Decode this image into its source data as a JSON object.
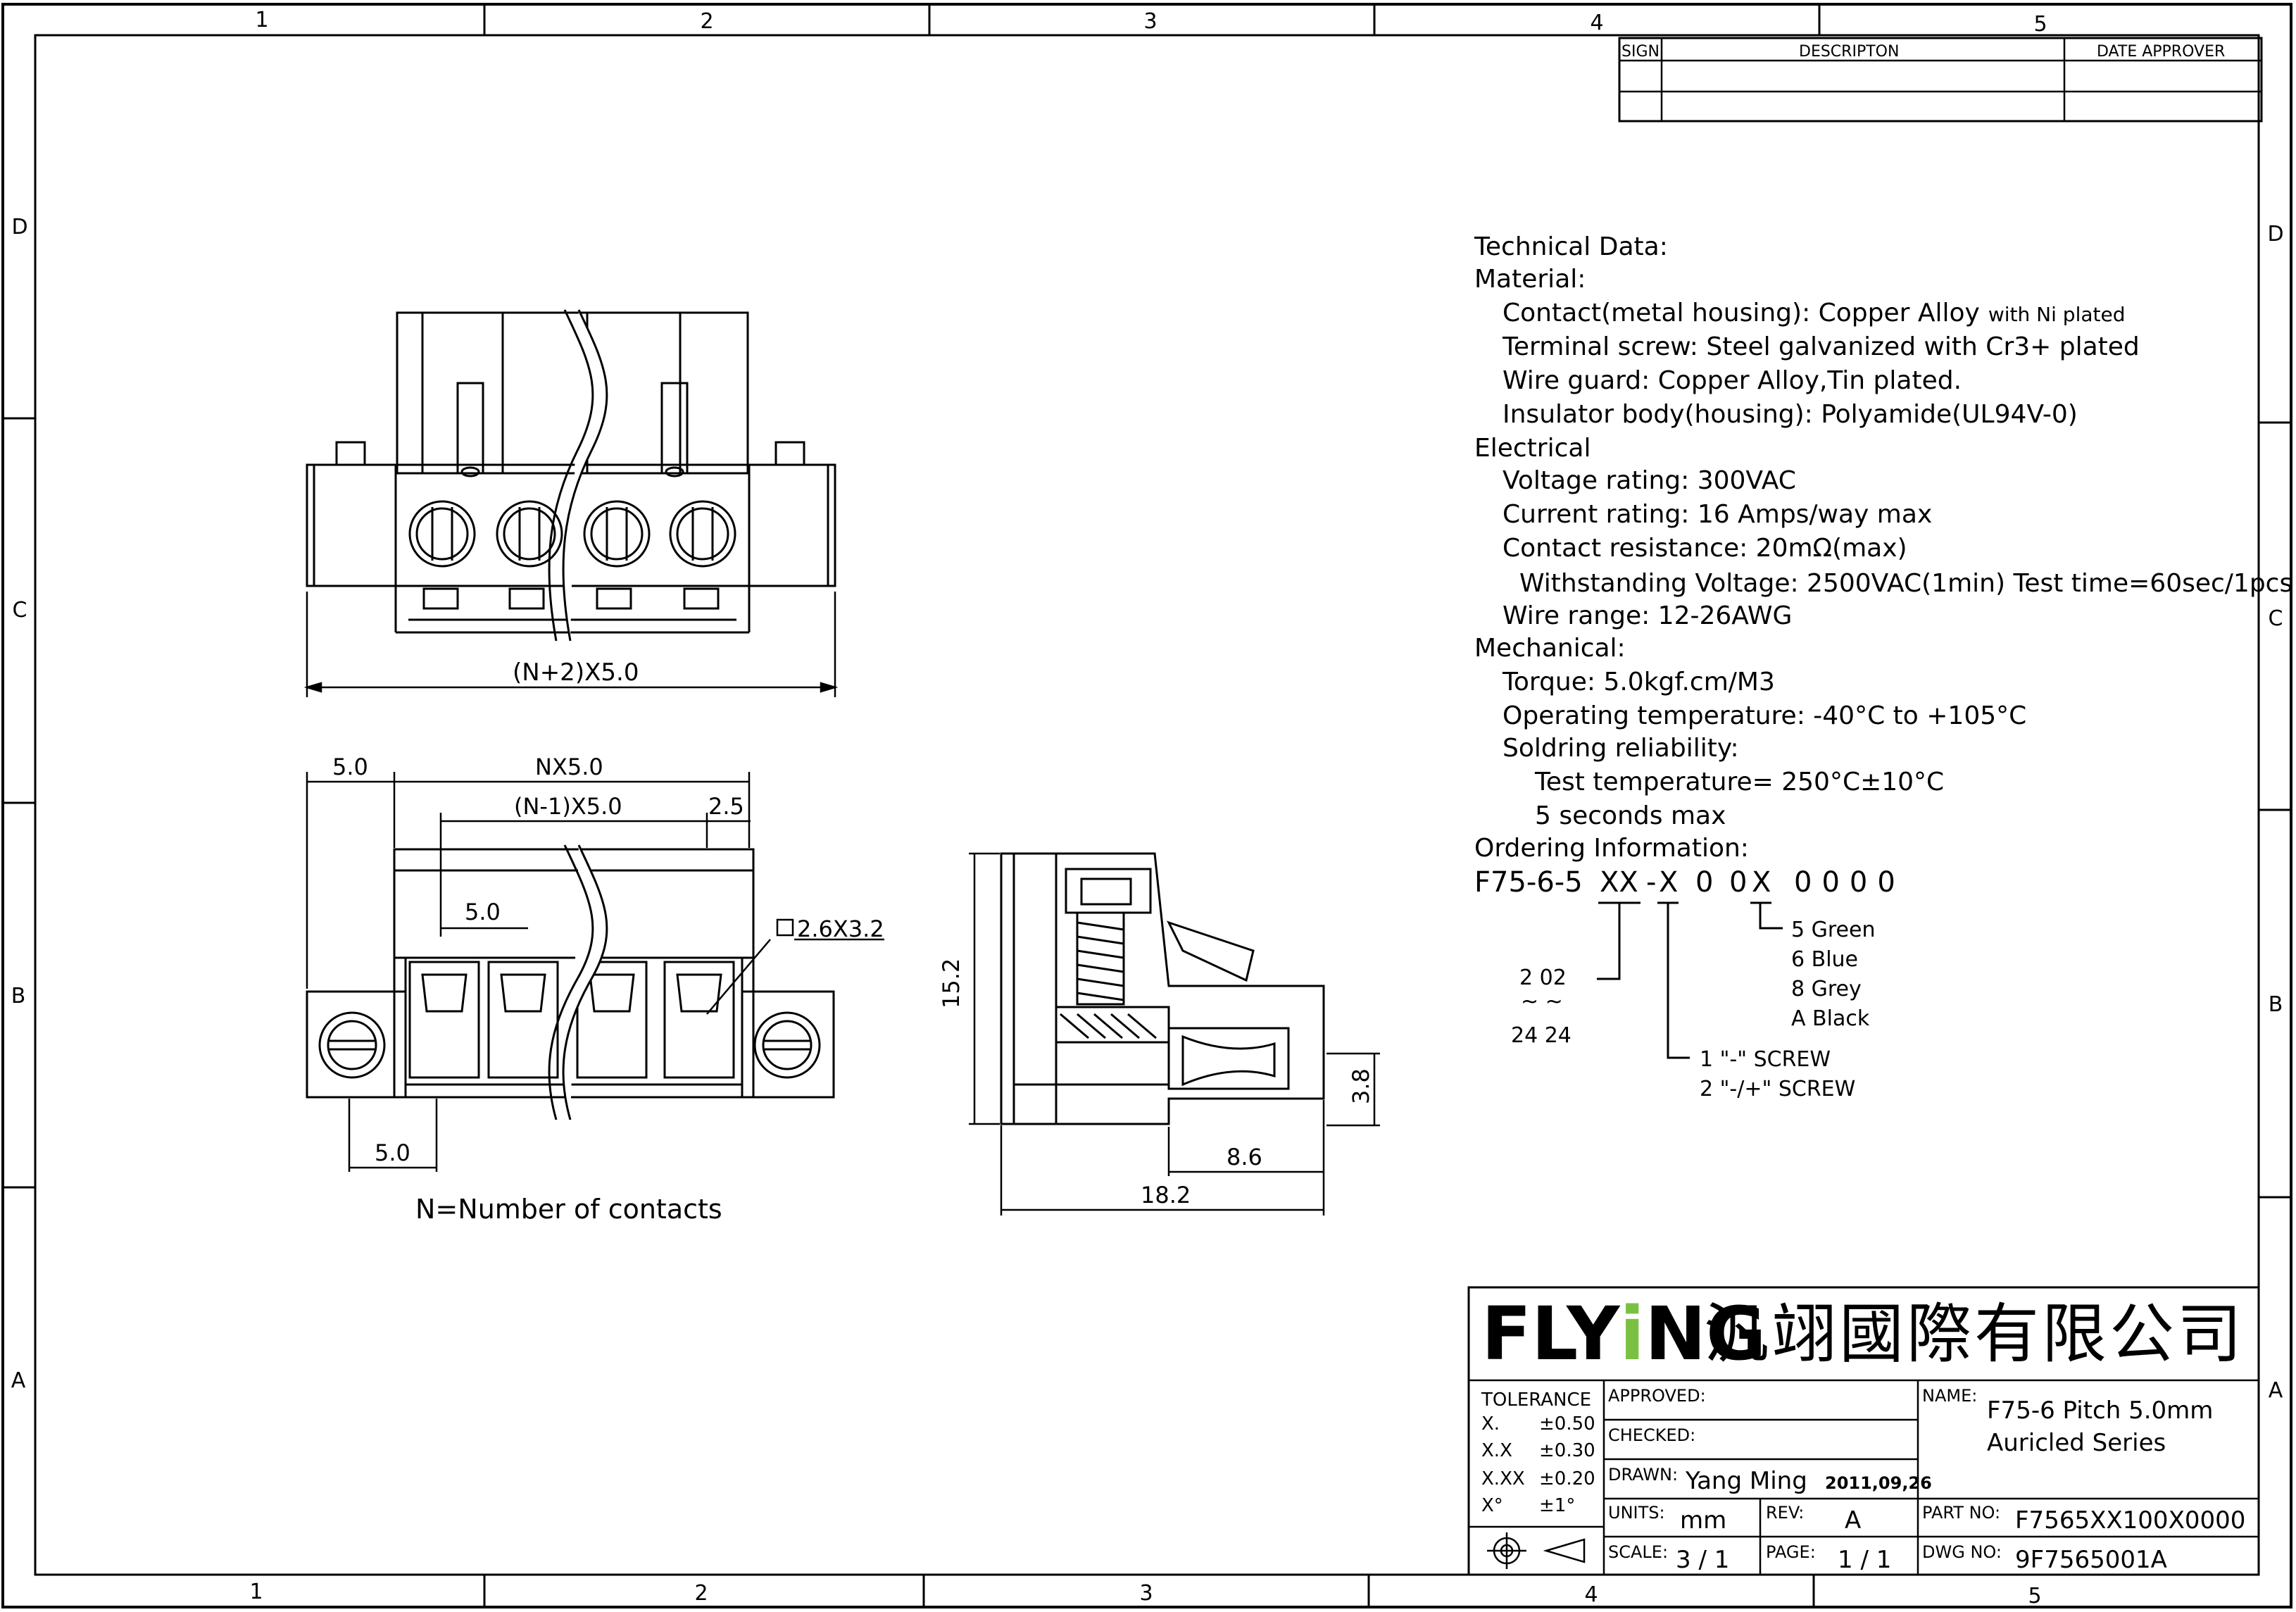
{
  "border": {
    "cols_top": [
      "1",
      "2",
      "3",
      "4",
      "5"
    ],
    "cols_bottom": [
      "1",
      "2",
      "3",
      "4",
      "5"
    ],
    "rows": [
      "D",
      "C",
      "B",
      "A"
    ]
  },
  "revision_table": {
    "headers": {
      "sign": "SIGN",
      "description": "DESCRIPTON",
      "date_approver": "DATE   APPROVER"
    }
  },
  "technical": {
    "heading": "Technical Data:",
    "material": "Material:",
    "contact_main": "Contact(metal housing): Copper Alloy",
    "contact_small": "with Ni plated",
    "screw": "Terminal screw: Steel galvanized with Cr3+ plated",
    "wire_guard": "Wire guard: Copper Alloy,Tin plated.",
    "insulator": "Insulator body(housing): Polyamide(UL94V-0)",
    "electrical": "Electrical",
    "voltage": "Voltage rating: 300VAC",
    "current": "Current rating: 16 Amps/way max",
    "resistance": "Contact resistance: 20mΩ(max)",
    "withstand": "Withstanding Voltage: 2500VAC(1min) Test time=60sec/1pcs",
    "wire_range": "Wire range: 12-26AWG",
    "mechanical": "Mechanical:",
    "torque": "Torque: 5.0kgf.cm/M3",
    "op_temp": "Operating temperature: -40°C to +105°C",
    "soldering": "Soldring reliability:",
    "test_temp": "Test temperature= 250°C±10°C",
    "seconds": "5 seconds max",
    "ordering": "Ordering Information:"
  },
  "ordering": {
    "code_prefix": "F75-6-5",
    "code_xx": "XX",
    "code_dash": "-",
    "code_x1": "X",
    "code_0a": "0",
    "code_0b": "0",
    "code_x2": "X",
    "code_tail": "0000",
    "colors": [
      "5   Green",
      "6   Blue",
      "8   Grey",
      "A   Black"
    ],
    "range_from": "2   02",
    "range_tilde": "~    ~",
    "range_to": "24   24",
    "screw_options": [
      "1   \"-\" SCREW",
      "2   \"-/+\" SCREW"
    ]
  },
  "dimensions": {
    "top_width": "(N+2)X5.0",
    "left_5": "5.0",
    "nx5": "NX5.0",
    "n1x5": "(N-1)X5.0",
    "d25": "2.5",
    "inner_5": "5.0",
    "square": "2.6X3.2",
    "bottom_5": "5.0",
    "n_note": "N=Number of contacts",
    "h152": "15.2",
    "h38": "3.8",
    "w86": "8.6",
    "w182": "18.2"
  },
  "title_block": {
    "brand": "FLYiNG",
    "company": "汎翊國際有限公司",
    "tolerance_label": "TOLERANCE",
    "tolerances": [
      {
        "k": "X.",
        "v": "±0.50"
      },
      {
        "k": "X.X",
        "v": "±0.30"
      },
      {
        "k": "X.XX",
        "v": "±0.20"
      },
      {
        "k": "X°",
        "v": "±1°"
      }
    ],
    "approved_label": "APPROVED:",
    "checked_label": "CHECKED:",
    "drawn_label": "DRAWN:",
    "drawn_name": "Yang Ming",
    "drawn_date": "2011,09,26",
    "units_label": "UNITS:",
    "units": "mm",
    "rev_label": "REV:",
    "rev": "A",
    "scale_label": "SCALE:",
    "scale": "3 / 1",
    "page_label": "PAGE:",
    "page": "1 / 1",
    "name_label": "NAME:",
    "name_line1": "F75-6 Pitch 5.0mm",
    "name_line2": "Auricled Series",
    "part_label": "PART NO:",
    "part_no": "F7565XX100X0000",
    "dwg_label": "DWG NO:",
    "dwg_no": "9F7565001A"
  },
  "colors": {
    "ink": "#000000",
    "brand_accent": "#7ac143"
  }
}
